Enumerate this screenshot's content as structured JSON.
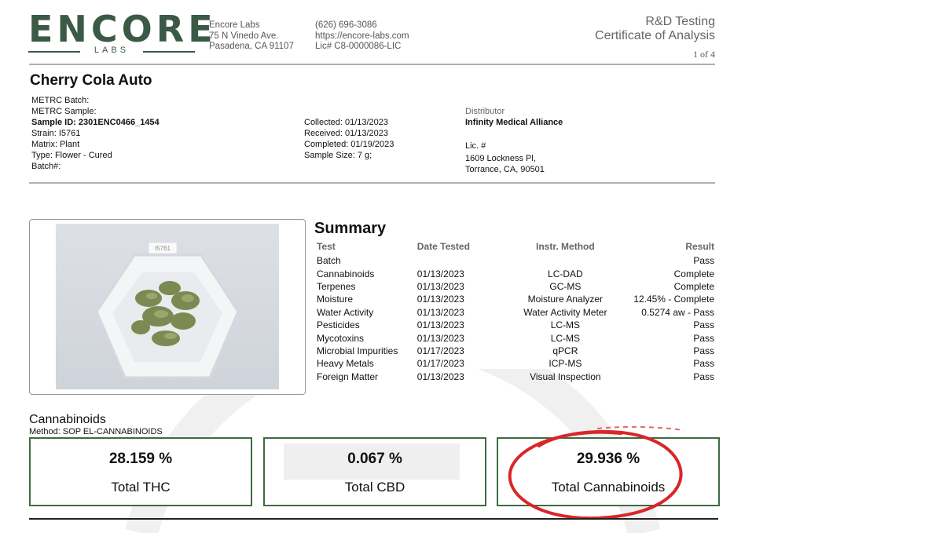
{
  "header": {
    "logo": {
      "word": "ENCORE",
      "sub": "LABS"
    },
    "address": [
      "Encore Labs",
      "75 N Vinedo Ave.",
      "Pasadena, CA 91107"
    ],
    "contact": [
      "(626) 696-3086",
      "https://encore-labs.com",
      "Lic# C8-0000086-LIC"
    ],
    "report": {
      "line1": "R&D Testing",
      "line2": "Certificate of Analysis",
      "page": "1 of 4"
    }
  },
  "product": {
    "title": "Cherry Cola Auto",
    "left": [
      {
        "text": "METRC Batch:",
        "bold": false
      },
      {
        "text": "METRC Sample:",
        "bold": false
      },
      {
        "text": "Sample ID: 2301ENC0466_1454",
        "bold": true
      },
      {
        "text": "Strain: I5761",
        "bold": false
      },
      {
        "text": "Matrix: Plant",
        "bold": false
      },
      {
        "text": "Type: Flower - Cured",
        "bold": false
      },
      {
        "text": "Batch#:",
        "bold": false
      }
    ],
    "middle": [
      "Collected: 01/13/2023",
      "Received: 01/13/2023",
      "Completed: 01/19/2023",
      "Sample Size: 7 g;"
    ],
    "distributor": {
      "label": "Distributor",
      "name": "Infinity Medical Alliance",
      "lic": "Lic. #",
      "address1": "1609 Lockness Pl,",
      "address2": "Torrance, CA, 90501"
    }
  },
  "photo": {
    "label": "I5761"
  },
  "summary": {
    "title": "Summary",
    "columns": [
      "Test",
      "Date Tested",
      "Instr. Method",
      "Result"
    ],
    "rows": [
      [
        "Batch",
        "",
        "",
        "Pass"
      ],
      [
        "Cannabinoids",
        "01/13/2023",
        "LC-DAD",
        "Complete"
      ],
      [
        "Terpenes",
        "01/13/2023",
        "GC-MS",
        "Complete"
      ],
      [
        "Moisture",
        "01/13/2023",
        "Moisture Analyzer",
        "12.45% - Complete"
      ],
      [
        "Water Activity",
        "01/13/2023",
        "Water Activity Meter",
        "0.5274 aw - Pass"
      ],
      [
        "Pesticides",
        "01/13/2023",
        "LC-MS",
        "Pass"
      ],
      [
        "Mycotoxins",
        "01/13/2023",
        "LC-MS",
        "Pass"
      ],
      [
        "Microbial Impurities",
        "01/17/2023",
        "qPCR",
        "Pass"
      ],
      [
        "Heavy Metals",
        "01/17/2023",
        "ICP-MS",
        "Pass"
      ],
      [
        "Foreign Matter",
        "01/13/2023",
        "Visual Inspection",
        "Pass"
      ]
    ]
  },
  "cannabinoids": {
    "title": "Cannabinoids",
    "method": "Method: SOP EL-CANNABINOIDS",
    "boxes": [
      {
        "value": "28.159 %",
        "label": "Total THC"
      },
      {
        "value": "0.067 %",
        "label": "Total CBD"
      },
      {
        "value": "29.936 %",
        "label": "Total Cannabinoids"
      }
    ]
  },
  "colors": {
    "brand": "#3b5a46",
    "box_border": "#3e6b40",
    "annotation": "#d8262a"
  }
}
